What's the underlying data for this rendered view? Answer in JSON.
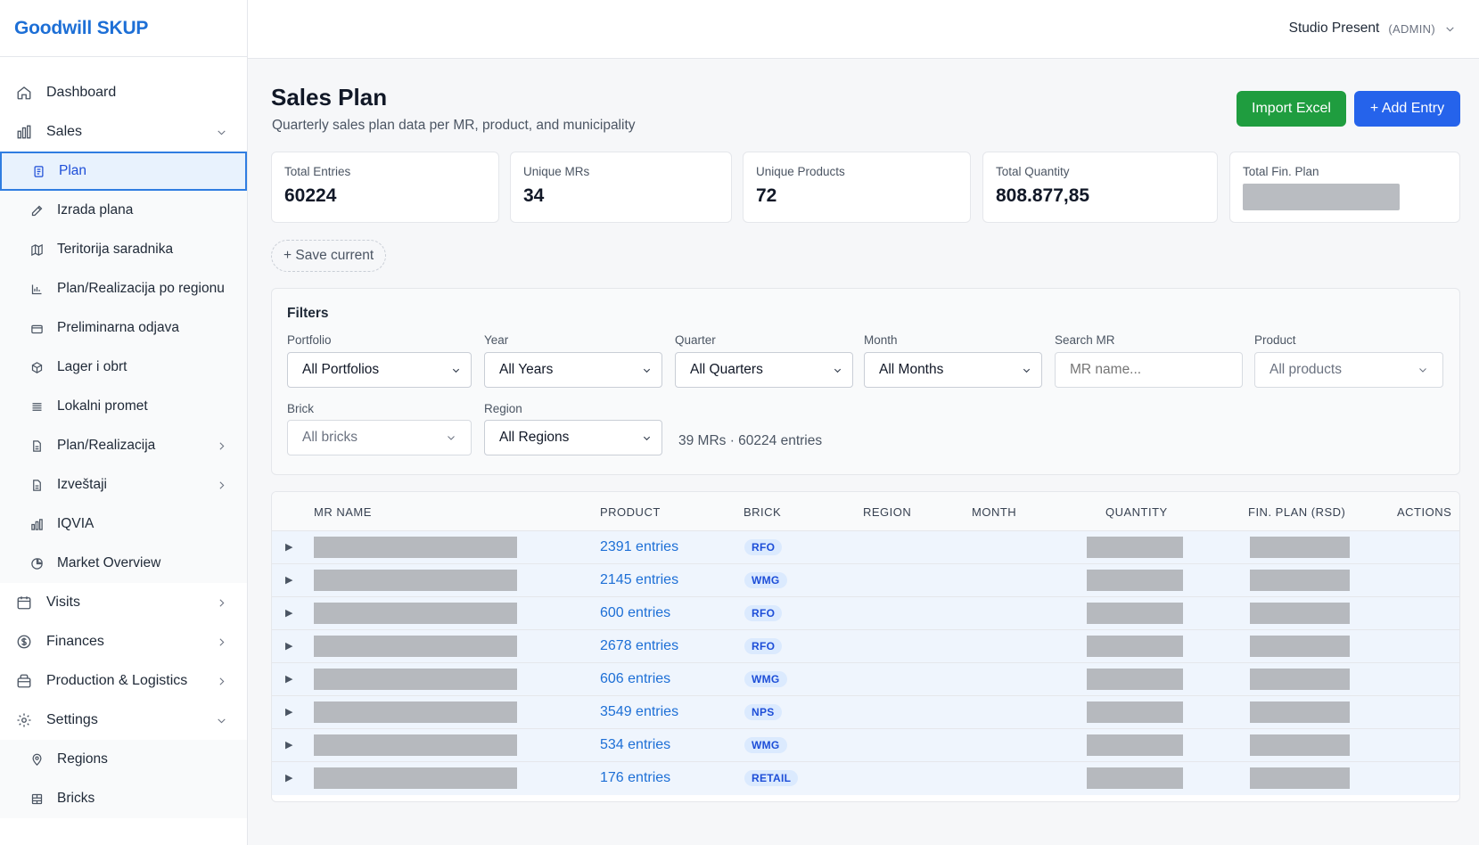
{
  "brand": {
    "name": "Goodwill SKUP",
    "color": "#1d6fd6"
  },
  "user": {
    "name": "Studio Present",
    "role": "(ADMIN)"
  },
  "sidebar": {
    "items": [
      {
        "label": "Dashboard",
        "icon": "home-icon"
      },
      {
        "label": "Sales",
        "icon": "bar-chart-icon",
        "expanded": true,
        "children": [
          {
            "label": "Plan",
            "icon": "document-icon",
            "active": true
          },
          {
            "label": "Izrada plana",
            "icon": "edit-icon"
          },
          {
            "label": "Teritorija saradnika",
            "icon": "map-icon"
          },
          {
            "label": "Plan/Realizacija po regionu",
            "icon": "bar-chart-icon"
          },
          {
            "label": "Preliminarna odjava",
            "icon": "box-icon"
          },
          {
            "label": "Lager i obrt",
            "icon": "cube-icon"
          },
          {
            "label": "Lokalni promet",
            "icon": "list-icon"
          },
          {
            "label": "Plan/Realizacija",
            "icon": "document-icon"
          },
          {
            "label": "Izveštaji",
            "icon": "document-icon"
          },
          {
            "label": "IQVIA",
            "icon": "bar-chart-icon"
          },
          {
            "label": "Market Overview",
            "icon": "pie-chart-icon"
          }
        ]
      },
      {
        "label": "Visits",
        "icon": "calendar-icon"
      },
      {
        "label": "Finances",
        "icon": "dollar-icon"
      },
      {
        "label": "Production & Logistics",
        "icon": "box-icon"
      },
      {
        "label": "Settings",
        "icon": "gear-icon",
        "expanded": true,
        "children": [
          {
            "label": "Regions",
            "icon": "location-pin-icon"
          },
          {
            "label": "Bricks",
            "icon": "grid-icon"
          }
        ]
      }
    ]
  },
  "page": {
    "title": "Sales Plan",
    "subtitle": "Quarterly sales plan data per MR, product, and municipality",
    "import_label": "Import Excel",
    "add_label": "+ Add Entry",
    "import_color": "#1f9d3f",
    "add_color": "#2563eb"
  },
  "stats": [
    {
      "label": "Total Entries",
      "value": "60224"
    },
    {
      "label": "Unique MRs",
      "value": "34"
    },
    {
      "label": "Unique Products",
      "value": "72"
    },
    {
      "label": "Total Quantity",
      "value": "808.877,85"
    },
    {
      "label": "Total Fin. Plan",
      "value": null
    }
  ],
  "save_current": "+ Save current",
  "filters": {
    "title": "Filters",
    "portfolio": {
      "label": "Portfolio",
      "value": "All Portfolios"
    },
    "year": {
      "label": "Year",
      "value": "All Years"
    },
    "quarter": {
      "label": "Quarter",
      "value": "All Quarters"
    },
    "month": {
      "label": "Month",
      "value": "All Months"
    },
    "search_mr": {
      "label": "Search MR",
      "placeholder": "MR name..."
    },
    "product": {
      "label": "Product",
      "value": "All products"
    },
    "brick": {
      "label": "Brick",
      "value": "All bricks"
    },
    "region": {
      "label": "Region",
      "value": "All Regions"
    },
    "summary": "39 MRs · 60224 entries"
  },
  "table": {
    "columns": [
      "MR NAME",
      "PRODUCT",
      "BRICK",
      "REGION",
      "MONTH",
      "QUANTITY",
      "FIN. PLAN (RSD)",
      "ACTIONS"
    ],
    "rows": [
      {
        "product": "2391 entries",
        "brick": "RFO"
      },
      {
        "product": "2145 entries",
        "brick": "WMG"
      },
      {
        "product": "600 entries",
        "brick": "RFO"
      },
      {
        "product": "2678 entries",
        "brick": "RFO"
      },
      {
        "product": "606 entries",
        "brick": "WMG"
      },
      {
        "product": "3549 entries",
        "brick": "NPS"
      },
      {
        "product": "534 entries",
        "brick": "WMG"
      },
      {
        "product": "176 entries",
        "brick": "RETAIL"
      }
    ]
  }
}
